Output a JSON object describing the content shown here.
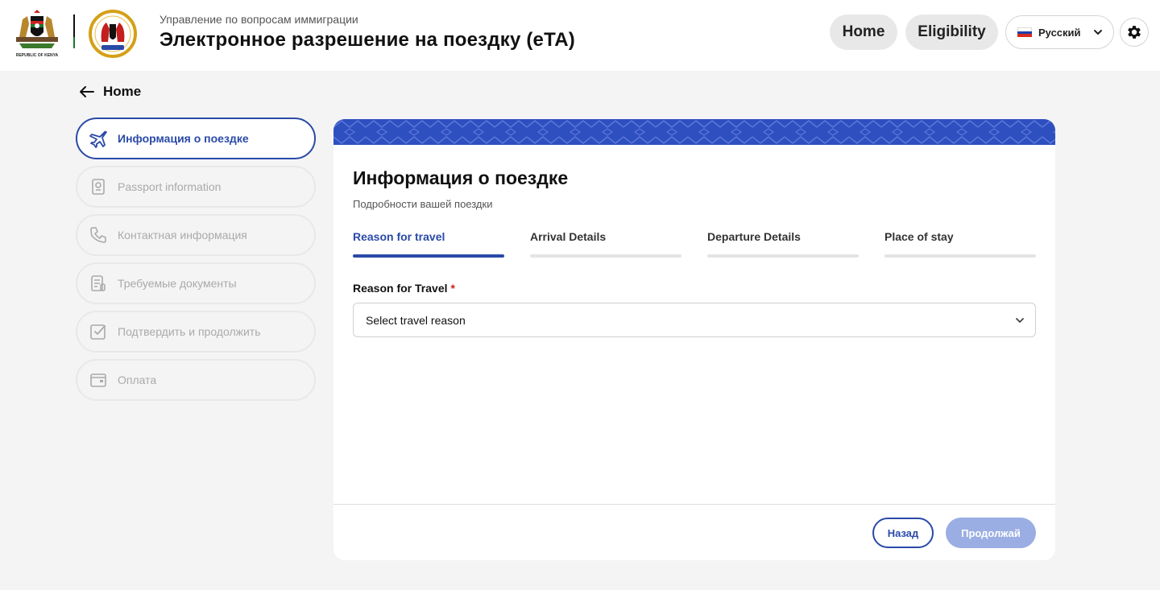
{
  "header": {
    "subtitle": "Управление по вопросам иммиграции",
    "title": "Электронное разрешение на поездку (eTA)",
    "logo_caption": "REPUBLIC OF KENYA",
    "nav": {
      "home": "Home",
      "eligibility": "Eligibility"
    },
    "language": {
      "selected": "Русский"
    }
  },
  "back": {
    "label": "Home"
  },
  "steps": [
    {
      "label": "Информация о поездке",
      "icon": "airplane-icon",
      "active": true
    },
    {
      "label": "Passport information",
      "icon": "passport-icon",
      "active": false
    },
    {
      "label": "Контактная информация",
      "icon": "phone-icon",
      "active": false
    },
    {
      "label": "Требуемые документы",
      "icon": "document-icon",
      "active": false
    },
    {
      "label": "Подтвердить и продолжить",
      "icon": "checkbox-icon",
      "active": false
    },
    {
      "label": "Оплата",
      "icon": "wallet-icon",
      "active": false
    }
  ],
  "main": {
    "title": "Информация о поездке",
    "subtitle": "Подробности вашей поездки",
    "tabs": [
      {
        "label": "Reason for travel",
        "active": true
      },
      {
        "label": "Arrival Details",
        "active": false
      },
      {
        "label": "Departure Details",
        "active": false
      },
      {
        "label": "Place of stay",
        "active": false
      }
    ],
    "field": {
      "label": "Reason for Travel",
      "required_mark": "*",
      "value": "Select travel reason"
    },
    "buttons": {
      "back": "Назад",
      "continue": "Продолжай"
    }
  },
  "colors": {
    "primary": "#2a4aa8",
    "banner": "#2d4fc0",
    "disabled_button": "#9aaee3",
    "required": "#d21f1f"
  }
}
